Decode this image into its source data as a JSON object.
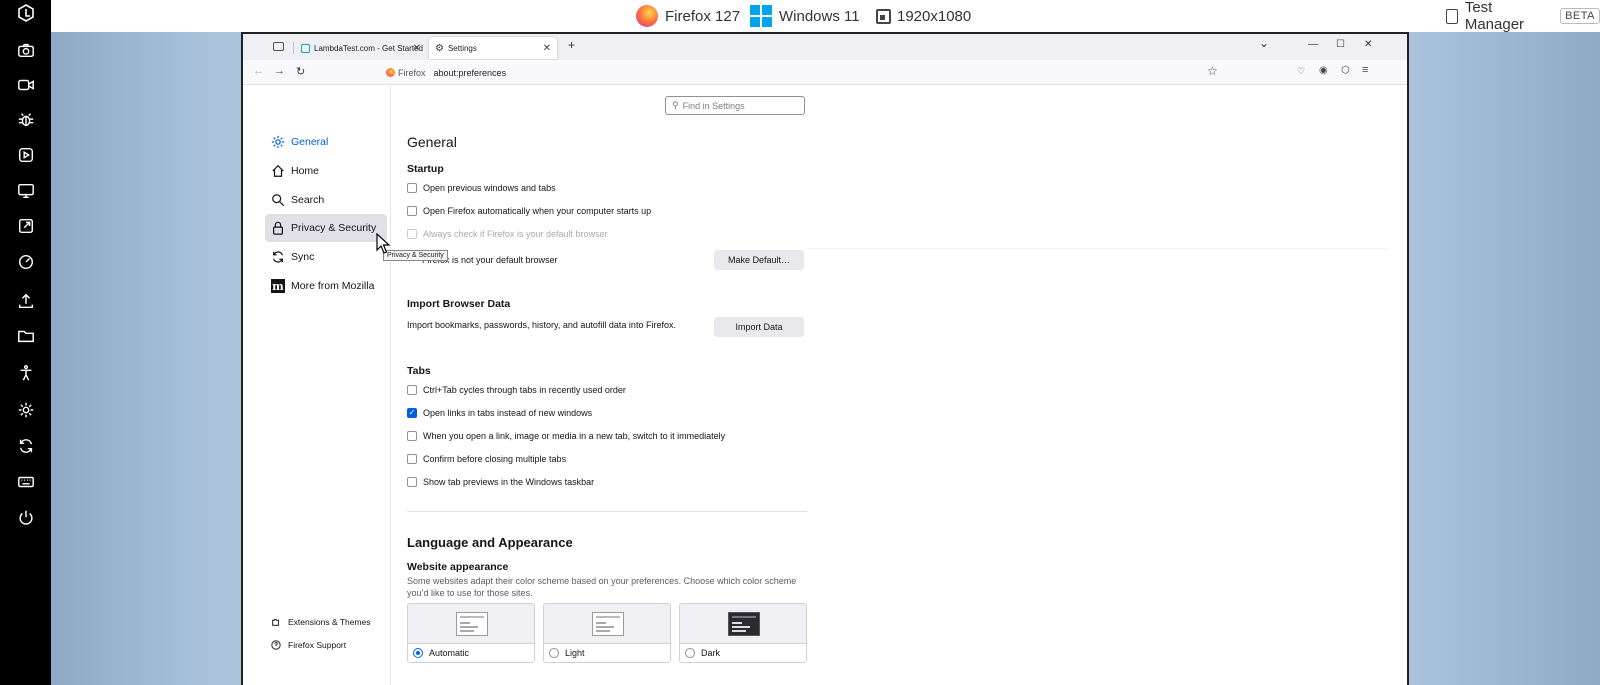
{
  "top_bar": {
    "browser": "Firefox 127",
    "os": "Windows 11",
    "resolution": "1920x1080",
    "test_manager": "Test Manager",
    "beta_badge": "BETA"
  },
  "rail_icons": [
    "lambdatest-logo-icon",
    "camera-icon",
    "video-icon",
    "bug-icon",
    "play-icon",
    "monitor-icon",
    "external-link-icon",
    "gauge-icon",
    "upload-icon",
    "folder-icon",
    "accessibility-icon",
    "settings-icon",
    "sync-icon",
    "keyboard-icon",
    "power-icon"
  ],
  "browser": {
    "tabs": [
      {
        "title": "LambdaTest.com - Get Started",
        "close": "✕"
      },
      {
        "title": "Settings",
        "close": "✕"
      }
    ],
    "new_tab": "+",
    "window_controls": {
      "list": "⌄",
      "minimize": "—",
      "maximize": "☐",
      "close": "✕"
    },
    "identity": "Firefox",
    "url": "about:preferences"
  },
  "sidebar": {
    "items": [
      {
        "label": "General",
        "icon": "gear-icon",
        "selected": true
      },
      {
        "label": "Home",
        "icon": "home-icon"
      },
      {
        "label": "Search",
        "icon": "search-icon"
      },
      {
        "label": "Privacy & Security",
        "icon": "lock-icon",
        "hover": true
      },
      {
        "label": "Sync",
        "icon": "sync-icon"
      },
      {
        "label": "More from Mozilla",
        "icon": "mozilla-icon"
      }
    ],
    "footer": [
      {
        "label": "Extensions & Themes",
        "icon": "puzzle-icon"
      },
      {
        "label": "Firefox Support",
        "icon": "help-icon"
      }
    ],
    "tooltip": "Privacy & Security"
  },
  "search": {
    "placeholder": "Find in Settings"
  },
  "general": {
    "title": "General",
    "startup": {
      "heading": "Startup",
      "options": [
        {
          "label": "Open previous windows and tabs",
          "checked": false
        },
        {
          "label": "Open Firefox automatically when your computer starts up",
          "checked": false
        },
        {
          "label": "Always check if Firefox is your default browser",
          "checked": false,
          "disabled": true
        }
      ],
      "default_status": "Firefox is not your default browser",
      "make_default_button": "Make Default…"
    },
    "import": {
      "heading": "Import Browser Data",
      "description": "Import bookmarks, passwords, history, and autofill data into Firefox.",
      "button": "Import Data"
    },
    "tabs": {
      "heading": "Tabs",
      "options": [
        {
          "label": "Ctrl+Tab cycles through tabs in recently used order",
          "checked": false
        },
        {
          "label": "Open links in tabs instead of new windows",
          "checked": true
        },
        {
          "label": "When you open a link, image or media in a new tab, switch to it immediately",
          "checked": false
        },
        {
          "label": "Confirm before closing multiple tabs",
          "checked": false
        },
        {
          "label": "Show tab previews in the Windows taskbar",
          "checked": false
        }
      ]
    }
  },
  "language": {
    "title": "Language and Appearance",
    "website_appearance": {
      "heading": "Website appearance",
      "description": "Some websites adapt their color scheme based on your preferences. Choose which color scheme you’d like to use for those sites.",
      "options": [
        {
          "label": "Automatic",
          "selected": true
        },
        {
          "label": "Light",
          "selected": false
        },
        {
          "label": "Dark",
          "selected": false
        }
      ]
    }
  },
  "colors": {
    "accent": "#0061e0",
    "rail": "#000000"
  }
}
